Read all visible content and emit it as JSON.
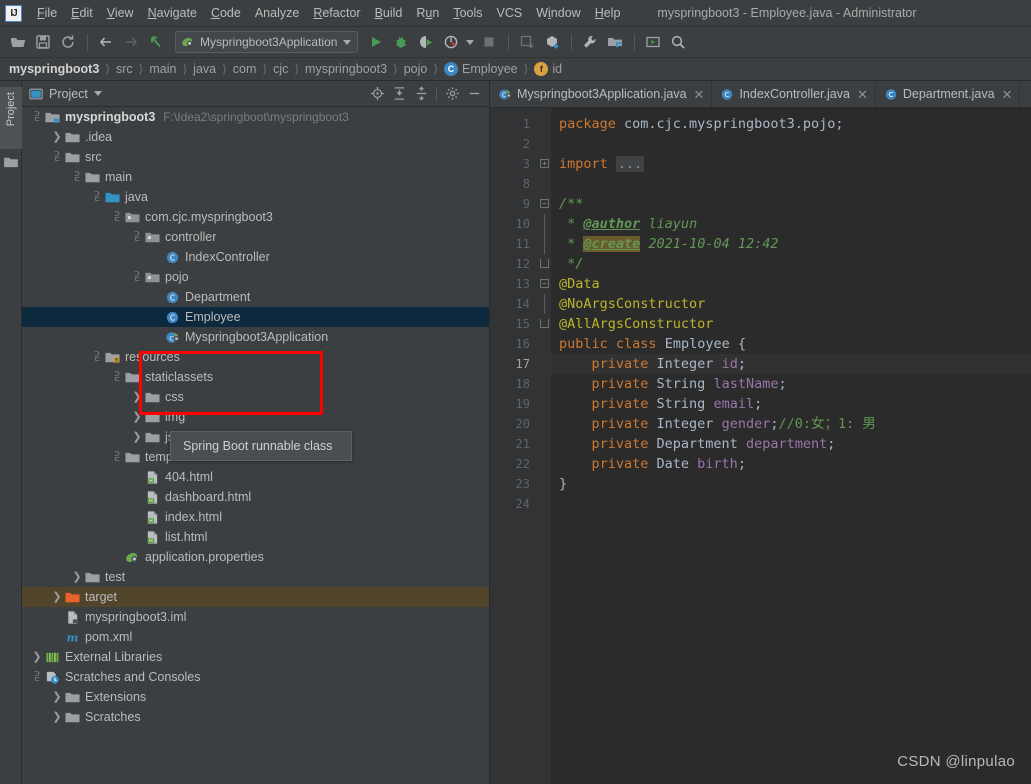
{
  "window": {
    "title": "myspringboot3 - Employee.java - Administrator"
  },
  "menubar": {
    "items": [
      {
        "label": "File",
        "mnemonic": "F"
      },
      {
        "label": "Edit",
        "mnemonic": "E"
      },
      {
        "label": "View",
        "mnemonic": "V"
      },
      {
        "label": "Navigate",
        "mnemonic": "N"
      },
      {
        "label": "Code",
        "mnemonic": "C"
      },
      {
        "label": "Analyze",
        "mnemonic": "A"
      },
      {
        "label": "Refactor",
        "mnemonic": "R"
      },
      {
        "label": "Build",
        "mnemonic": "B"
      },
      {
        "label": "Run",
        "mnemonic": "R"
      },
      {
        "label": "Tools",
        "mnemonic": "T"
      },
      {
        "label": "VCS",
        "mnemonic": ""
      },
      {
        "label": "Window",
        "mnemonic": "W"
      },
      {
        "label": "Help",
        "mnemonic": "H"
      }
    ]
  },
  "toolbar": {
    "run_configuration": "Myspringboot3Application",
    "icons": [
      "open-project-icon",
      "save-all-icon",
      "sync-icon",
      "back-icon",
      "forward-icon",
      "pointer-icon",
      "run-icon",
      "debug-icon",
      "run-with-coverage-icon",
      "profiler-icon",
      "stop-icon",
      "update-project-icon",
      "commit-icon",
      "settings-wrench-icon",
      "project-structure-icon",
      "select-in-icon",
      "search-everywhere-icon"
    ]
  },
  "breadcrumb": {
    "items": [
      {
        "label": "myspringboot3",
        "bold": true,
        "icon": ""
      },
      {
        "label": "src",
        "bold": false,
        "icon": ""
      },
      {
        "label": "main",
        "bold": false,
        "icon": ""
      },
      {
        "label": "java",
        "bold": false,
        "icon": ""
      },
      {
        "label": "com",
        "bold": false,
        "icon": ""
      },
      {
        "label": "cjc",
        "bold": false,
        "icon": ""
      },
      {
        "label": "myspringboot3",
        "bold": false,
        "icon": ""
      },
      {
        "label": "pojo",
        "bold": false,
        "icon": ""
      },
      {
        "label": "Employee",
        "bold": false,
        "icon": "class"
      },
      {
        "label": "id",
        "bold": false,
        "icon": "field"
      }
    ]
  },
  "rail": {
    "project_tab": "Project"
  },
  "project_panel": {
    "title": "Project",
    "tools": [
      "locate-icon",
      "expand-all-icon",
      "collapse-all-icon",
      "settings-gear-icon",
      "hide-icon"
    ],
    "tree": [
      {
        "indent": 0,
        "twisty": "down",
        "icon": "module-folder",
        "label": "myspringboot3",
        "bold": true,
        "path": "F:\\Idea2\\springboot\\myspringboot3",
        "state": "normal"
      },
      {
        "indent": 1,
        "twisty": "right",
        "icon": "folder",
        "label": ".idea",
        "bold": false,
        "path": "",
        "state": "normal"
      },
      {
        "indent": 1,
        "twisty": "down",
        "icon": "folder",
        "label": "src",
        "bold": false,
        "path": "",
        "state": "normal"
      },
      {
        "indent": 2,
        "twisty": "down",
        "icon": "folder",
        "label": "main",
        "bold": false,
        "path": "",
        "state": "normal"
      },
      {
        "indent": 3,
        "twisty": "down",
        "icon": "source-folder",
        "label": "java",
        "bold": false,
        "path": "",
        "state": "normal"
      },
      {
        "indent": 4,
        "twisty": "down",
        "icon": "package",
        "label": "com.cjc.myspringboot3",
        "bold": false,
        "path": "",
        "state": "normal"
      },
      {
        "indent": 5,
        "twisty": "down",
        "icon": "package",
        "label": "controller",
        "bold": false,
        "path": "",
        "state": "normal"
      },
      {
        "indent": 6,
        "twisty": "none",
        "icon": "java-class",
        "label": "IndexController",
        "bold": false,
        "path": "",
        "state": "normal"
      },
      {
        "indent": 5,
        "twisty": "down",
        "icon": "package",
        "label": "pojo",
        "bold": false,
        "path": "",
        "state": "normal"
      },
      {
        "indent": 6,
        "twisty": "none",
        "icon": "java-class",
        "label": "Department",
        "bold": false,
        "path": "",
        "state": "normal"
      },
      {
        "indent": 6,
        "twisty": "none",
        "icon": "java-class",
        "label": "Employee",
        "bold": false,
        "path": "",
        "state": "selected"
      },
      {
        "indent": 6,
        "twisty": "none",
        "icon": "spring-boot-class",
        "label": "Myspringboot3Application",
        "bold": false,
        "path": "",
        "state": "normal"
      },
      {
        "indent": 3,
        "twisty": "down",
        "icon": "resource-folder",
        "label": "resources",
        "bold": false,
        "path": "",
        "state": "normal"
      },
      {
        "indent": 4,
        "twisty": "down",
        "icon": "folder",
        "label": "staticlassets",
        "bold": false,
        "path": "",
        "state": "normal"
      },
      {
        "indent": 5,
        "twisty": "right",
        "icon": "folder",
        "label": "css",
        "bold": false,
        "path": "",
        "state": "normal"
      },
      {
        "indent": 5,
        "twisty": "right",
        "icon": "folder",
        "label": "img",
        "bold": false,
        "path": "",
        "state": "normal"
      },
      {
        "indent": 5,
        "twisty": "right",
        "icon": "folder",
        "label": "js",
        "bold": false,
        "path": "",
        "state": "normal"
      },
      {
        "indent": 4,
        "twisty": "down",
        "icon": "folder",
        "label": "templates",
        "bold": false,
        "path": "",
        "state": "normal"
      },
      {
        "indent": 5,
        "twisty": "none",
        "icon": "html-file",
        "label": "404.html",
        "bold": false,
        "path": "",
        "state": "normal"
      },
      {
        "indent": 5,
        "twisty": "none",
        "icon": "html-file",
        "label": "dashboard.html",
        "bold": false,
        "path": "",
        "state": "normal"
      },
      {
        "indent": 5,
        "twisty": "none",
        "icon": "html-file",
        "label": "index.html",
        "bold": false,
        "path": "",
        "state": "normal"
      },
      {
        "indent": 5,
        "twisty": "none",
        "icon": "html-file",
        "label": "list.html",
        "bold": false,
        "path": "",
        "state": "normal"
      },
      {
        "indent": 4,
        "twisty": "none",
        "icon": "spring-properties",
        "label": "application.properties",
        "bold": false,
        "path": "",
        "state": "normal"
      },
      {
        "indent": 2,
        "twisty": "right",
        "icon": "folder",
        "label": "test",
        "bold": false,
        "path": "",
        "state": "normal"
      },
      {
        "indent": 1,
        "twisty": "right",
        "icon": "excluded-folder",
        "label": "target",
        "bold": false,
        "path": "",
        "state": "excluded"
      },
      {
        "indent": 1,
        "twisty": "none",
        "icon": "iml-file",
        "label": "myspringboot3.iml",
        "bold": false,
        "path": "",
        "state": "normal"
      },
      {
        "indent": 1,
        "twisty": "none",
        "icon": "maven-file",
        "label": "pom.xml",
        "bold": false,
        "path": "",
        "state": "normal"
      },
      {
        "indent": 0,
        "twisty": "right",
        "icon": "libraries",
        "label": "External Libraries",
        "bold": false,
        "path": "",
        "state": "normal"
      },
      {
        "indent": 0,
        "twisty": "down",
        "icon": "scratches",
        "label": "Scratches and Consoles",
        "bold": false,
        "path": "",
        "state": "normal"
      },
      {
        "indent": 1,
        "twisty": "right",
        "icon": "folder",
        "label": "Extensions",
        "bold": false,
        "path": "",
        "state": "normal"
      },
      {
        "indent": 1,
        "twisty": "right",
        "icon": "folder",
        "label": "Scratches",
        "bold": false,
        "path": "",
        "state": "normal"
      }
    ]
  },
  "tooltip": {
    "text": "Spring Boot runnable class"
  },
  "editor": {
    "tabs": [
      {
        "label": "Myspringboot3Application.java",
        "icon": "spring-boot-class",
        "active": false,
        "closable": true
      },
      {
        "label": "IndexController.java",
        "icon": "java-class",
        "active": false,
        "closable": true
      },
      {
        "label": "Department.java",
        "icon": "java-class",
        "active": false,
        "closable": true
      }
    ],
    "line_numbers": [
      "1",
      "2",
      "3",
      "8",
      "9",
      "10",
      "11",
      "12",
      "13",
      "14",
      "15",
      "16",
      "17",
      "18",
      "19",
      "20",
      "21",
      "22",
      "23",
      "24"
    ],
    "caret_line_index": 12,
    "lines": [
      {
        "n": "1",
        "text": "package com.cjc.myspringboot3.pojo;"
      },
      {
        "n": "2",
        "text": ""
      },
      {
        "n": "3",
        "text": "import ..."
      },
      {
        "n": "8",
        "text": ""
      },
      {
        "n": "9",
        "text": "/**"
      },
      {
        "n": "10",
        "text": " * @author liayun"
      },
      {
        "n": "11",
        "text": " * @create 2021-10-04 12:42"
      },
      {
        "n": "12",
        "text": " */"
      },
      {
        "n": "13",
        "text": "@Data"
      },
      {
        "n": "14",
        "text": "@NoArgsConstructor"
      },
      {
        "n": "15",
        "text": "@AllArgsConstructor"
      },
      {
        "n": "16",
        "text": "public class Employee {"
      },
      {
        "n": "17",
        "text": "    private Integer id;"
      },
      {
        "n": "18",
        "text": "    private String lastName;"
      },
      {
        "n": "19",
        "text": "    private String email;"
      },
      {
        "n": "20",
        "text": "    private Integer gender;//0:女；1: 男"
      },
      {
        "n": "21",
        "text": "    private Department department;"
      },
      {
        "n": "22",
        "text": "    private Date birth;"
      },
      {
        "n": "23",
        "text": "}"
      },
      {
        "n": "24",
        "text": ""
      }
    ],
    "tokens": {
      "l1_kw": "package",
      "l1_rest": " com.cjc.myspringboot3.pojo;",
      "l3_kw": "import",
      "l3_fold": "...",
      "l9": "/**",
      "l10_star": " * ",
      "l10_tag": "@author",
      "l10_val": " liayun",
      "l11_star": " * ",
      "l11_tag": "@create",
      "l11_val": " 2021-10-04 12:42",
      "l12": " */",
      "l13": "@Data",
      "l14": "@NoArgsConstructor",
      "l15": "@AllArgsConstructor",
      "l16_kw1": "public",
      "l16_kw2": " class",
      "l16_name": " Employee",
      "l16_brace": " {",
      "l17_kw": "    private",
      "l17_type": " Integer",
      "l17_name": " id",
      "l17_semi": ";",
      "l18_kw": "    private",
      "l18_type": " String",
      "l18_name": " lastName",
      "l18_semi": ";",
      "l19_kw": "    private",
      "l19_type": " String",
      "l19_name": " email",
      "l19_semi": ";",
      "l20_kw": "    private",
      "l20_type": " Integer",
      "l20_name": " gender",
      "l20_semi": ";",
      "l20_comment": "//0:女；1: 男",
      "l21_kw": "    private",
      "l21_type": " Department",
      "l21_name": " department",
      "l21_semi": ";",
      "l22_kw": "    private",
      "l22_type": " Date",
      "l22_name": " birth",
      "l22_semi": ";",
      "l23": "}"
    }
  },
  "watermark": {
    "text": "CSDN @linpulao"
  },
  "colors": {
    "chrome_bg": "#3c3f41",
    "editor_bg": "#2b2b2b",
    "gutter_bg": "#313335",
    "selection_blue": "#0d293e",
    "excluded_olive": "#50452a",
    "annotation_red": "#ff0000",
    "accent_blue": "#4a88c7",
    "keyword_orange": "#cc7832",
    "annotation_yellow": "#bbb529",
    "field_purple": "#9876aa",
    "comment_green": "#629755"
  }
}
